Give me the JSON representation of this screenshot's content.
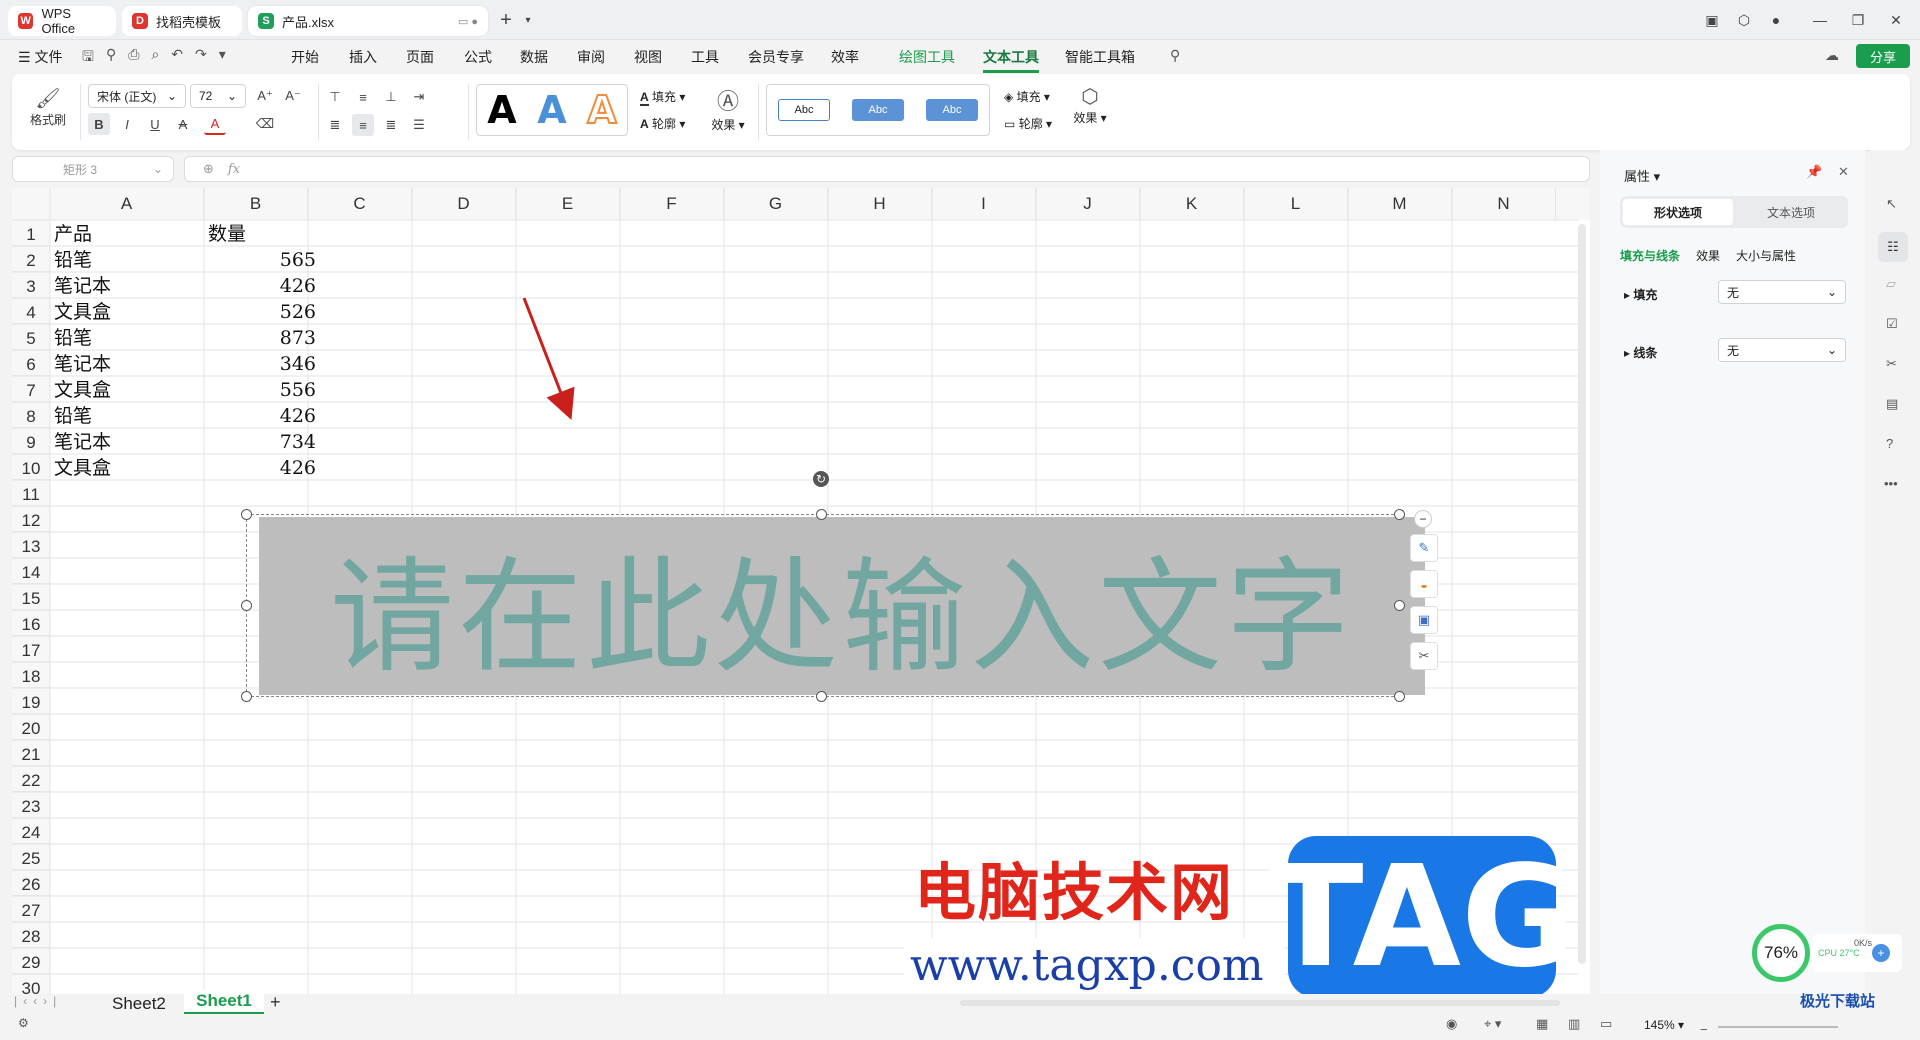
{
  "tabs": [
    {
      "label": "WPS Office"
    },
    {
      "label": "找稻壳模板"
    },
    {
      "label": "产品.xlsx"
    }
  ],
  "menu": {
    "file": "文件",
    "items": [
      "开始",
      "插入",
      "页面",
      "公式",
      "数据",
      "审阅",
      "视图",
      "工具",
      "会员专享",
      "效率",
      "绘图工具",
      "文本工具",
      "智能工具箱"
    ],
    "share": "分享"
  },
  "ribbon": {
    "format_painter": "格式刷",
    "font_name": "宋体 (正文)",
    "font_size": "72",
    "fill": "填充",
    "outline": "轮廓",
    "effect": "效果",
    "style_samples": [
      "A",
      "A",
      "A"
    ],
    "shape_samples": [
      "Abc",
      "Abc",
      "Abc"
    ]
  },
  "formula": {
    "name_box": "矩形 3",
    "fx": "fx",
    "value": ""
  },
  "columns": [
    "A",
    "B",
    "C",
    "D",
    "E",
    "F",
    "G",
    "H",
    "I",
    "J",
    "K",
    "L",
    "M",
    "N"
  ],
  "rows": [
    "1",
    "2",
    "3",
    "4",
    "5",
    "6",
    "7",
    "8",
    "9",
    "10",
    "11",
    "12",
    "13",
    "14",
    "15",
    "16",
    "17",
    "18",
    "19",
    "20",
    "21",
    "22",
    "23",
    "24",
    "25",
    "26",
    "27",
    "28",
    "29",
    "30"
  ],
  "table": {
    "headers": [
      "产品",
      "数量"
    ],
    "rows": [
      [
        "铅笔",
        "565"
      ],
      [
        "笔记本",
        "426"
      ],
      [
        "文具盒",
        "526"
      ],
      [
        "铅笔",
        "873"
      ],
      [
        "笔记本",
        "346"
      ],
      [
        "文具盒",
        "556"
      ],
      [
        "铅笔",
        "426"
      ],
      [
        "笔记本",
        "734"
      ],
      [
        "文具盒",
        "426"
      ]
    ]
  },
  "textbox": {
    "text": "请在此处输入文字",
    "fill": "#bdbdbd",
    "text_color": "#6fa5a0"
  },
  "sheets": [
    "Sheet2",
    "Sheet1"
  ],
  "panel": {
    "title": "属性",
    "tabs": [
      "形状选项",
      "文本选项"
    ],
    "subtabs": [
      "填充与线条",
      "效果",
      "大小与属性"
    ],
    "fill_label": "填充",
    "fill_value": "无",
    "line_label": "线条",
    "line_value": "无"
  },
  "status": {
    "zoom": "145%"
  },
  "watermark": {
    "site": "电脑技术网",
    "url": "www.tagxp.com",
    "tag": "TAG",
    "logo2": "极光下载站"
  },
  "monitor": {
    "percent": "76%",
    "speed": "0K/s",
    "cpu": "CPU 27°C"
  },
  "colors": {
    "accent": "#1a9d4c",
    "wps_red": "#e0342f",
    "selected_tab": "#1f9f59"
  }
}
